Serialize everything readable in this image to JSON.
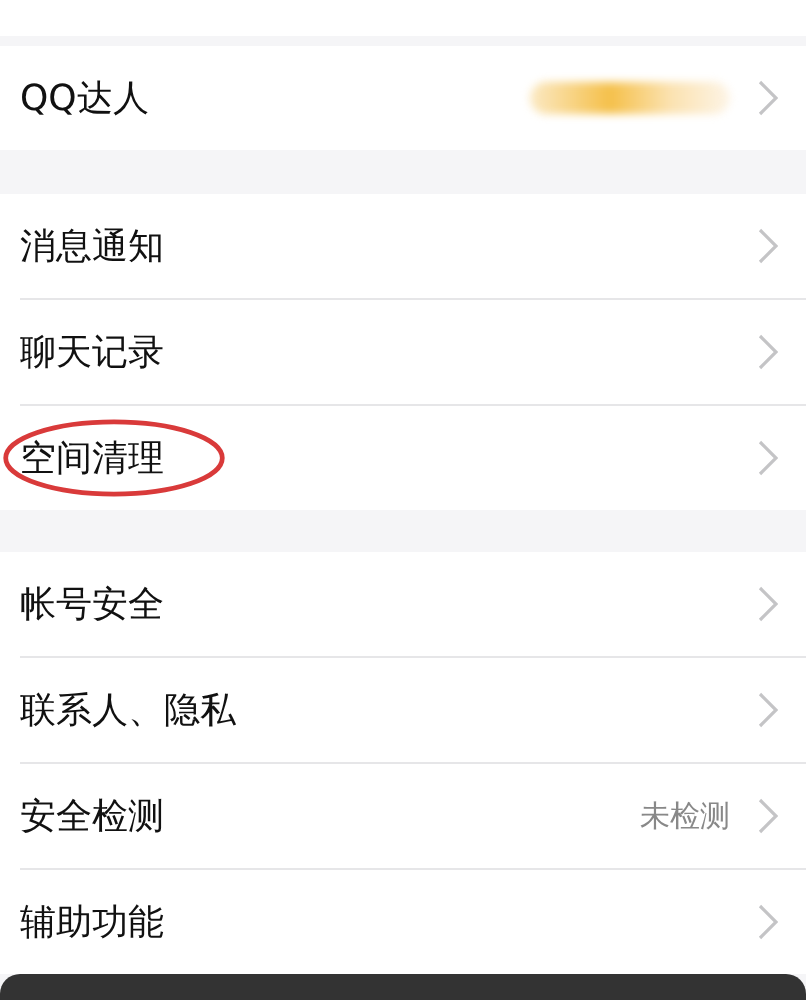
{
  "sections": [
    {
      "items": [
        {
          "label": "QQ达人",
          "value": "",
          "kind": "blurred",
          "circled": false
        }
      ]
    },
    {
      "items": [
        {
          "label": "消息通知",
          "value": "",
          "kind": "plain",
          "circled": false
        },
        {
          "label": "聊天记录",
          "value": "",
          "kind": "plain",
          "circled": false
        },
        {
          "label": "空间清理",
          "value": "",
          "kind": "plain",
          "circled": true
        }
      ]
    },
    {
      "items": [
        {
          "label": "帐号安全",
          "value": "",
          "kind": "plain",
          "circled": false
        },
        {
          "label": "联系人、隐私",
          "value": "",
          "kind": "plain",
          "circled": false
        },
        {
          "label": "安全检测",
          "value": "未检测",
          "kind": "plain",
          "circled": false
        },
        {
          "label": "辅助功能",
          "value": "",
          "kind": "plain",
          "circled": false
        }
      ]
    }
  ]
}
